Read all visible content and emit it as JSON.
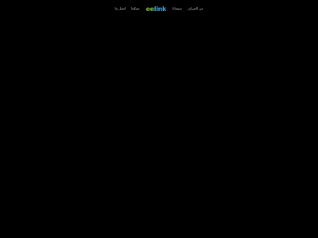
{
  "nav": {
    "items": [
      {
        "label": "من الصراف"
      },
      {
        "label": "سينمانا"
      }
    ],
    "logo": {
      "part_a": "ee",
      "part_b": "link"
    },
    "items_after_logo": [
      {
        "label": "شبكتنا"
      },
      {
        "label": "اتصل بنا"
      }
    ]
  },
  "colors": {
    "background": "#000000",
    "nav_text": "#d8d8d8",
    "logo_green": "#7ab648",
    "logo_blue": "#3fa7e0"
  }
}
